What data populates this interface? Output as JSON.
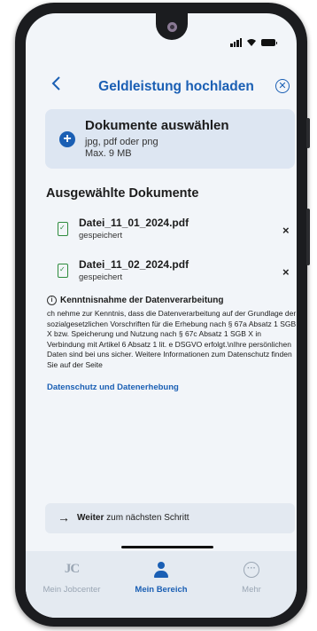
{
  "header": {
    "title": "Geldleistung hochladen",
    "back_icon": "chevron-left-icon",
    "close_icon": "close-circle-icon"
  },
  "upload": {
    "title": "Dokumente auswählen",
    "formats": "jpg, pdf oder png",
    "max_size": "Max. 9 MB"
  },
  "selected": {
    "title": "Ausgewählte Dokumente",
    "documents": [
      {
        "name": "Datei_11_01_2024.pdf",
        "status": "gespeichert"
      },
      {
        "name": "Datei_11_02_2024.pdf",
        "status": "gespeichert"
      }
    ],
    "remove_label": "×"
  },
  "info": {
    "title": "Kenntnisnahme der Datenverarbeitung",
    "text": "ch nehme zur Kenntnis, dass die Datenverarbeitung auf der Grundlage der sozialgesetzlichen Vorschriften für die Erhebung nach § 67a Absatz 1 SGB X bzw. Speicherung und Nutzung nach § 67c Absatz 1 SGB X in Verbindung mit Artikel 6 Absatz 1 lit. e DSGVO erfolgt.\\nIhre persönlichen Daten sind bei uns sicher. Weitere Informationen zum Datenschutz finden Sie auf der Seite",
    "link": "Datenschutz und Datenerhebung"
  },
  "next": {
    "bold": "Weiter",
    "rest": " zum nächsten Schritt"
  },
  "nav": {
    "items": [
      {
        "label": "Mein Jobcenter",
        "icon_text": "JC",
        "active": false
      },
      {
        "label": "Mein Bereich",
        "active": true
      },
      {
        "label": "Mehr",
        "icon_text": "···",
        "active": false
      }
    ]
  },
  "colors": {
    "accent": "#1a5fb4",
    "success": "#2e8b3e",
    "inactive": "#9aa6b4"
  }
}
